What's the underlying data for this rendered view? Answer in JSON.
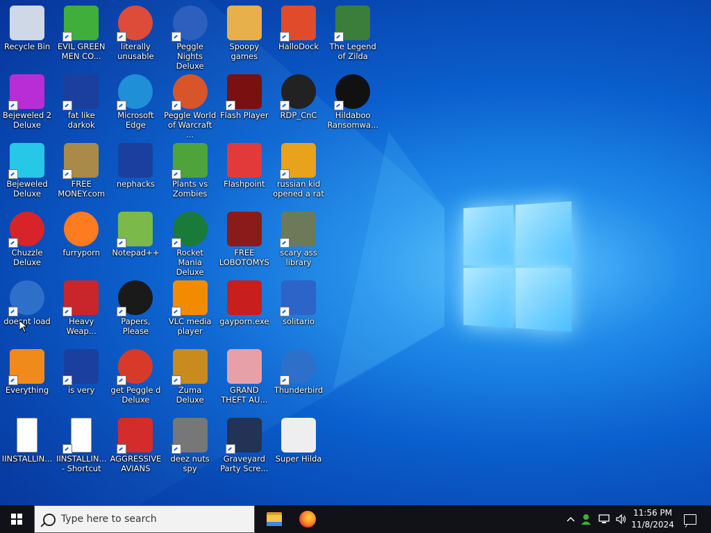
{
  "desktop": {
    "icons": [
      {
        "label": "Recycle Bin",
        "icon": "recycle-bin-icon",
        "color": "#cfd8e6",
        "shortcut": false
      },
      {
        "label": "EVIL GREEN MEN CO...",
        "icon": "green-men-icon",
        "color": "#3fae3a",
        "shortcut": true
      },
      {
        "label": "literally unusable",
        "icon": "chrome-icon",
        "color": "#dd4b39",
        "shortcut": true
      },
      {
        "label": "Peggle Nights Deluxe",
        "icon": "peggle-nights-icon",
        "color": "#2d5fbf",
        "shortcut": true
      },
      {
        "label": "Spoopy games",
        "icon": "folder-icon",
        "color": "#e7b04a",
        "shortcut": false
      },
      {
        "label": "HalloDock",
        "icon": "windows-shield-icon",
        "color": "#e04b2b",
        "shortcut": true
      },
      {
        "label": "The Legend of Zilda",
        "icon": "zelda-character-icon",
        "color": "#3b7d3a",
        "shortcut": true
      },
      {
        "label": "Bejeweled 2 Deluxe",
        "icon": "bejeweled-2-icon",
        "color": "#b92dd6",
        "shortcut": true
      },
      {
        "label": "fat like darkok",
        "icon": "mpi-icon",
        "color": "#1b3f9e",
        "shortcut": true
      },
      {
        "label": "Microsoft Edge",
        "icon": "edge-icon",
        "color": "#1f8fd8",
        "shortcut": true
      },
      {
        "label": "Peggle World of Warcraft ...",
        "icon": "peggle-wow-icon",
        "color": "#d8552a",
        "shortcut": true
      },
      {
        "label": "Flash Player",
        "icon": "flash-player-icon",
        "color": "#7a1010",
        "shortcut": true
      },
      {
        "label": "RDP_CnC",
        "icon": "rdp-icon",
        "color": "#222222",
        "shortcut": true
      },
      {
        "label": "Hildaboo Ransomwa...",
        "icon": "yashma-icon",
        "color": "#111111",
        "shortcut": true
      },
      {
        "label": "Bejeweled Deluxe",
        "icon": "diamond-icon",
        "color": "#27c7e8",
        "shortcut": true
      },
      {
        "label": "FREE MONEY.com",
        "icon": "money-bag-icon",
        "color": "#a98a48",
        "shortcut": true
      },
      {
        "label": "nephacks",
        "icon": "mpi-icon",
        "color": "#1b3f9e",
        "shortcut": false
      },
      {
        "label": "Plants vs Zombies",
        "icon": "plants-vs-zombies-icon",
        "color": "#4ea43a",
        "shortcut": true
      },
      {
        "label": "Flashpoint",
        "icon": "flashpoint-icon",
        "color": "#e23a3a",
        "shortcut": false
      },
      {
        "label": "russian kid opened a rat",
        "icon": "de-icon",
        "color": "#e8a21b",
        "shortcut": true
      },
      {
        "label": "",
        "icon": "",
        "color": "",
        "shortcut": false
      },
      {
        "label": "Chuzzle Deluxe",
        "icon": "chuzzle-icon",
        "color": "#d8232b",
        "shortcut": true
      },
      {
        "label": "furryporn",
        "icon": "firefox-icon",
        "color": "#ff7b1f",
        "shortcut": false
      },
      {
        "label": "Notepad++",
        "icon": "notepad-plus-icon",
        "color": "#7bb94b",
        "shortcut": true
      },
      {
        "label": "Rocket Mania Deluxe",
        "icon": "rocket-mania-icon",
        "color": "#1a7a3a",
        "shortcut": true
      },
      {
        "label": "FREE LOBOTOMYS",
        "icon": "lobotomy-icon",
        "color": "#8b1a1a",
        "shortcut": false
      },
      {
        "label": "scary ass library",
        "icon": "library-icon",
        "color": "#6c7a5a",
        "shortcut": true
      },
      {
        "label": "",
        "icon": "",
        "color": "",
        "shortcut": false
      },
      {
        "label": "doesnt load",
        "icon": "thunderbird-icon",
        "color": "#2e6fc9",
        "shortcut": true
      },
      {
        "label": "Heavy Weap...",
        "icon": "radiation-icon",
        "color": "#c8262b",
        "shortcut": true
      },
      {
        "label": "Papers, Please",
        "icon": "papers-please-icon",
        "color": "#1a1a1a",
        "shortcut": true
      },
      {
        "label": "VLC media player",
        "icon": "vlc-icon",
        "color": "#f28b00",
        "shortcut": true
      },
      {
        "label": "gayporn.exe",
        "icon": "flash-icon",
        "color": "#c81e1e",
        "shortcut": false
      },
      {
        "label": "solitario",
        "icon": "solitaire-icon",
        "color": "#2d64c8",
        "shortcut": true
      },
      {
        "label": "",
        "icon": "",
        "color": "",
        "shortcut": false
      },
      {
        "label": "Everything",
        "icon": "everything-search-icon",
        "color": "#f08a1a",
        "shortcut": true
      },
      {
        "label": "is very",
        "icon": "mpi-shield-icon",
        "color": "#1b3f9e",
        "shortcut": true
      },
      {
        "label": "get Peggle d Deluxe",
        "icon": "peggle-icon",
        "color": "#d83a2a",
        "shortcut": true
      },
      {
        "label": "Zuma Deluxe",
        "icon": "zuma-icon",
        "color": "#c98a1e",
        "shortcut": true
      },
      {
        "label": "GRAND THEFT AU...",
        "icon": "anime-girl-icon",
        "color": "#e8a0a8",
        "shortcut": false
      },
      {
        "label": "Thunderbird",
        "icon": "thunderbird-icon",
        "color": "#2e6fc9",
        "shortcut": true
      },
      {
        "label": "",
        "icon": "",
        "color": "",
        "shortcut": false
      },
      {
        "label": "IINSTALLIN...",
        "icon": "text-document-icon",
        "color": "#ffffff",
        "shortcut": false
      },
      {
        "label": "IINSTALLIN... - Shortcut",
        "icon": "text-document-icon",
        "color": "#ffffff",
        "shortcut": true
      },
      {
        "label": "AGGRESSIVE AVIANS",
        "icon": "angry-bird-icon",
        "color": "#d42b2b",
        "shortcut": true
      },
      {
        "label": "deez nuts spy",
        "icon": "stacked-windows-icon",
        "color": "#777777",
        "shortcut": true
      },
      {
        "label": "Graveyard Party Scre...",
        "icon": "graveyard-icon",
        "color": "#223355",
        "shortcut": true
      },
      {
        "label": "Super Hilda",
        "icon": "pixel-character-icon",
        "color": "#eeeeee",
        "shortcut": false
      }
    ]
  },
  "taskbar": {
    "search_placeholder": "Type here to search",
    "pinned": [
      {
        "name": "File Explorer",
        "icon": "file-explorer-icon"
      },
      {
        "name": "Firefox",
        "icon": "firefox-icon"
      }
    ],
    "tray": {
      "chevron": "^",
      "clock_time": "11:56 PM",
      "clock_date": "11/8/2024"
    }
  }
}
